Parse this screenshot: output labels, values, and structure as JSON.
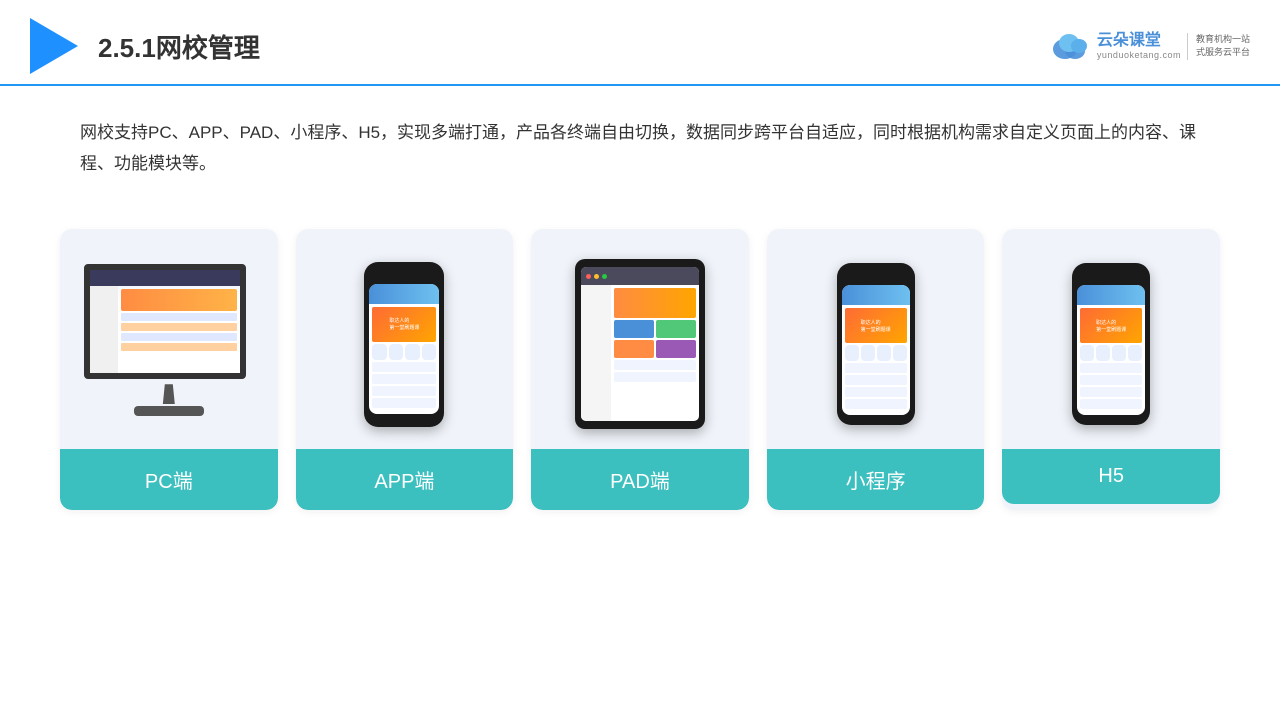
{
  "header": {
    "title": "2.5.1网校管理",
    "brand_name": "云朵课堂",
    "brand_sub": "yunduoketang.com",
    "tagline_line1": "教育机构一站",
    "tagline_line2": "式服务云平台"
  },
  "description": {
    "text": "网校支持PC、APP、PAD、小程序、H5，实现多端打通，产品各终端自由切换，数据同步跨平台自适应，同时根据机构需求自定义页面上的内容、课程、功能模块等。"
  },
  "cards": [
    {
      "id": "pc",
      "label": "PC端"
    },
    {
      "id": "app",
      "label": "APP端"
    },
    {
      "id": "pad",
      "label": "PAD端"
    },
    {
      "id": "miniprogram",
      "label": "小程序"
    },
    {
      "id": "h5",
      "label": "H5"
    }
  ],
  "colors": {
    "accent_blue": "#1E90FF",
    "teal": "#3CBFBF",
    "border_bottom": "#2196F3"
  }
}
